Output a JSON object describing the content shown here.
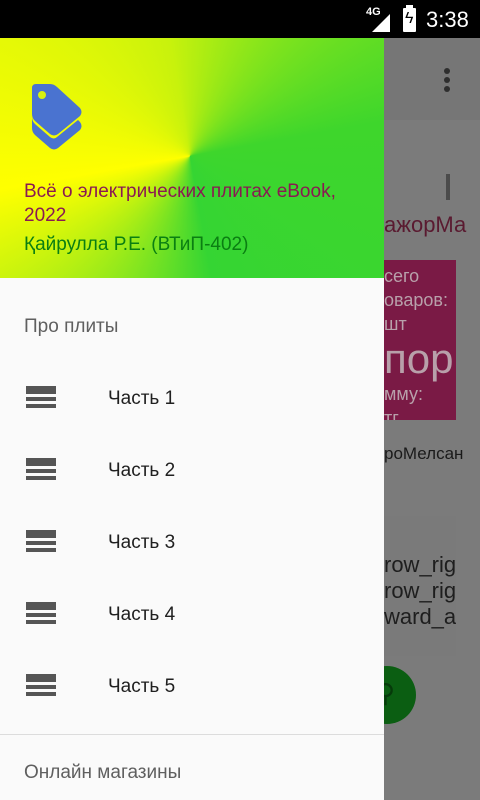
{
  "status_bar": {
    "network": "4G",
    "time": "3:38"
  },
  "background_app": {
    "line1": "ажорМа",
    "card_lines": [
      "сего",
      "оваров:",
      "шт",
      "а",
      "мму:",
      "тг"
    ],
    "card_big": "пор",
    "line2": "роМелсан",
    "card2_lines": [
      "row_rig",
      "row_righ",
      "ward_ar"
    ]
  },
  "drawer": {
    "header": {
      "title": "Всё о электрических плитах eBook, 2022",
      "author": "Қайрулла Р.Е. (ВТиП-402)",
      "gradient_colors": [
        "#ffff00",
        "#3ed62c"
      ],
      "title_color": "#8a1a52",
      "author_color": "#0a7f12",
      "logo_color": "#4a73d0"
    },
    "section1": "Про плиты",
    "items": [
      {
        "label": "Часть 1",
        "icon": "list-icon"
      },
      {
        "label": "Часть 2",
        "icon": "list-icon"
      },
      {
        "label": "Часть 3",
        "icon": "list-icon"
      },
      {
        "label": "Часть 4",
        "icon": "list-icon"
      },
      {
        "label": "Часть 5",
        "icon": "list-icon"
      }
    ],
    "section2": "Онлайн магазины"
  }
}
